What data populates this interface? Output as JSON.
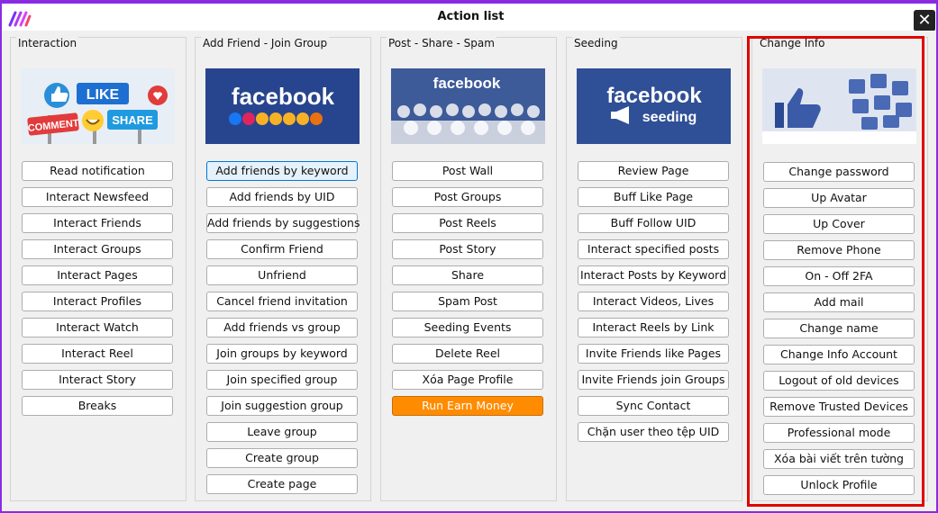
{
  "window": {
    "title": "Action list",
    "close_icon": "close-icon",
    "logo_icon": "app-logo-icon"
  },
  "colors": {
    "frame": "#8a2be2",
    "highlight_border": "#e00000",
    "accent_button": "#ff8c00",
    "facebook_blue": "#3b5998"
  },
  "banners": {
    "interaction": {
      "words": [
        "LIKE",
        "COMMENT",
        "SHARE"
      ]
    },
    "add_friend": {
      "brand": "facebook"
    },
    "post_share": {
      "brand": "facebook"
    },
    "seeding": {
      "brand": "facebook",
      "sub": "seeding"
    },
    "change_info": {
      "icon": "thumbs-up-icon"
    }
  },
  "columns": [
    {
      "title": "Interaction",
      "buttons": [
        "Read notification",
        "Interact Newsfeed",
        "Interact Friends",
        "Interact Groups",
        "Interact Pages",
        "Interact Profiles",
        "Interact Watch",
        "Interact Reel",
        "Interact Story",
        "Breaks"
      ]
    },
    {
      "title": "Add Friend - Join Group",
      "buttons": [
        "Add friends by keyword",
        "Add friends by UID",
        "Add friends by suggestions",
        "Confirm Friend",
        "Unfriend",
        "Cancel friend invitation",
        "Add friends vs group",
        "Join groups by keyword",
        "Join specified group",
        "Join suggestion group",
        "Leave group",
        "Create group",
        "Create page"
      ]
    },
    {
      "title": "Post - Share - Spam",
      "buttons": [
        "Post Wall",
        "Post Groups",
        "Post Reels",
        "Post Story",
        "Share",
        "Spam Post",
        "Seeding Events",
        "Delete Reel",
        "Xóa Page Profile",
        "Run Earn Money"
      ]
    },
    {
      "title": "Seeding",
      "buttons": [
        "Review Page",
        "Buff Like Page",
        "Buff Follow UID",
        "Interact specified posts",
        "Interact Posts by Keyword",
        "Interact Videos, Lives",
        "Interact Reels by Link",
        "Invite Friends like Pages",
        "Invite Friends join Groups",
        "Sync Contact",
        "Chặn user theo tệp UID"
      ]
    },
    {
      "title": "Change Info",
      "buttons": [
        "Change password",
        "Up Avatar",
        "Up Cover",
        "Remove Phone",
        "On - Off 2FA",
        "Add mail",
        "Change name",
        "Change Info Account",
        "Logout of old devices",
        "Remove Trusted Devices",
        "Professional mode",
        "Xóa bài viết trên tường",
        "Unlock Profile"
      ]
    }
  ]
}
